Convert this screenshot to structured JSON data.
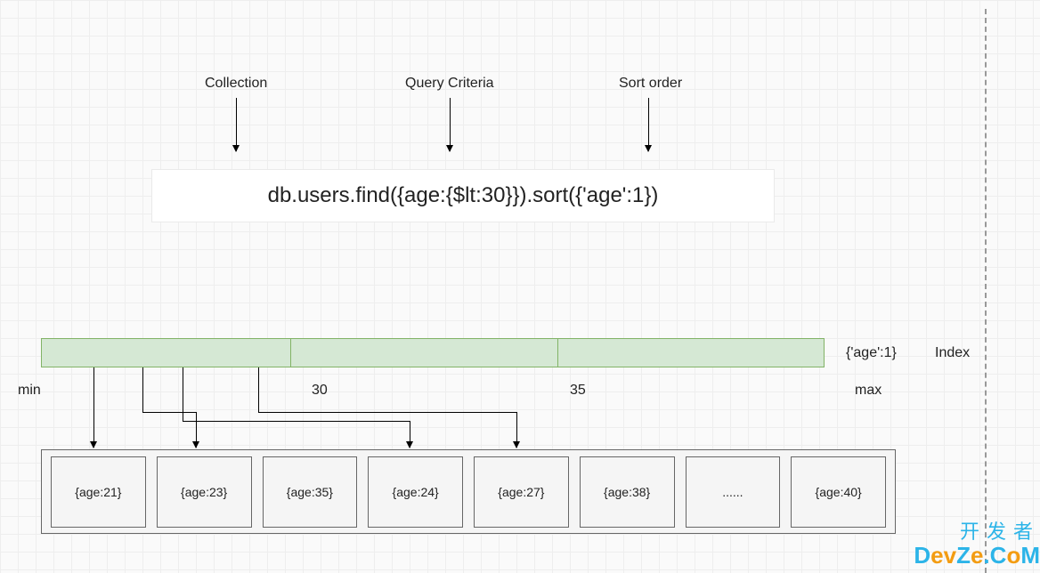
{
  "labels": {
    "collection": "Collection",
    "criteria": "Query Criteria",
    "sort": "Sort order",
    "index_key": "{'age':1}",
    "index": "Index",
    "min": "min",
    "max": "max",
    "mid1": "30",
    "mid2": "35"
  },
  "query": "db.users.find({age:{$lt:30}}).sort({'age':1})",
  "docs": [
    "{age:21}",
    "{age:23}",
    "{age:35}",
    "{age:24}",
    "{age:27}",
    "{age:38}",
    "......",
    "{age:40}"
  ],
  "watermark": {
    "top": "开发者",
    "bottom": "DevZe.CoM"
  }
}
